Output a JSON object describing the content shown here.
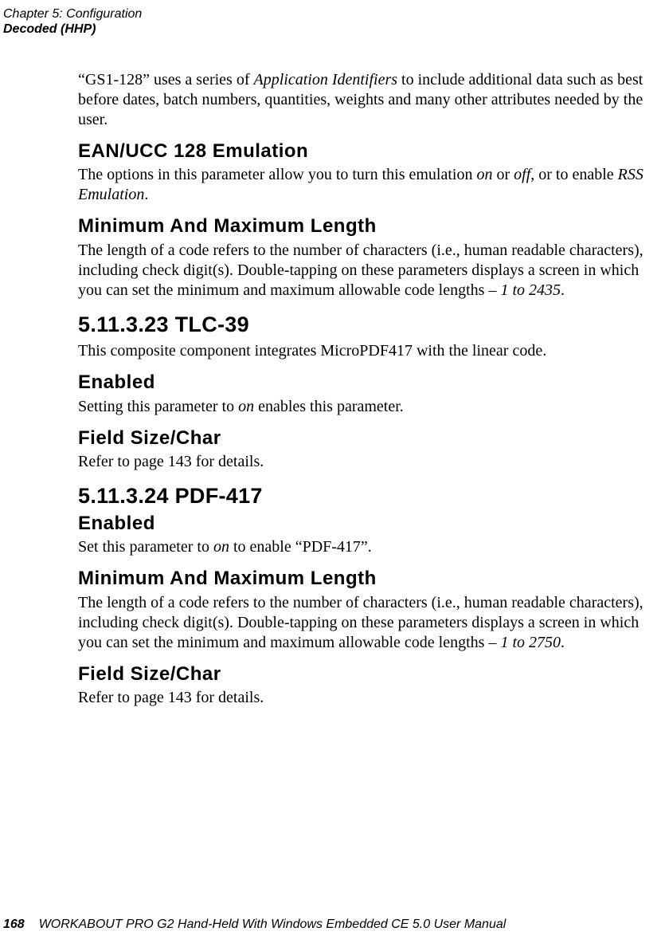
{
  "header": {
    "chapter_line": "Chapter 5: Configuration",
    "section_line": "Decoded (HHP)"
  },
  "body": {
    "gs1_para_pre": "“GS1-128” uses a series of ",
    "gs1_para_italic": "Application Identifiers",
    "gs1_para_post": " to include additional data such as best before dates, batch numbers, quantities, weights and many other attributes needed by the user.",
    "ean_heading": "EAN/UCC 128 Emulation",
    "ean_para_pre": "The options in this parameter allow you to turn this emulation ",
    "ean_para_on": "on",
    "ean_para_mid1": " or ",
    "ean_para_off": "off",
    "ean_para_mid2": ", or to enable ",
    "ean_para_rss": "RSS Emulation",
    "ean_para_post": ".",
    "minmax_heading": "Minimum And Maximum Length",
    "minmax1_pre": "The length of a code refers to the number of characters (i.e., human readable characters), including check digit(s). Double-tapping on these parameters displays a screen in which you can set the minimum and maximum allowable code lengths – ",
    "minmax1_italic": "1 to 2435",
    "minmax1_post": ".",
    "tlc_heading": "5.11.3.23  TLC-39",
    "tlc_para": "This composite component integrates MicroPDF417 with the linear code.",
    "enabled_heading": "Enabled",
    "enabled1_pre": "Setting this parameter to ",
    "enabled1_italic": "on",
    "enabled1_post": " enables this parameter.",
    "fieldsize_heading": "Field Size/Char",
    "fieldsize_para": "Refer to page 143 for details.",
    "pdf_heading": "5.11.3.24  PDF-417",
    "enabled2_heading": "Enabled",
    "enabled2_pre": "Set this parameter to ",
    "enabled2_italic": "on",
    "enabled2_post": " to enable “PDF-417”.",
    "minmax2_heading": "Minimum And Maximum Length",
    "minmax2_pre": "The length of a code refers to the number of characters (i.e., human readable characters), including check digit(s). Double-tapping on these parameters displays a screen in which you can set the minimum and maximum allowable code lengths – ",
    "minmax2_italic": "1 to 2750",
    "minmax2_post": ".",
    "fieldsize2_heading": "Field Size/Char",
    "fieldsize2_para": "Refer to page 143 for details."
  },
  "footer": {
    "page_number": "168",
    "manual_title": "WORKABOUT PRO G2 Hand-Held With Windows Embedded CE 5.0 User Manual"
  }
}
